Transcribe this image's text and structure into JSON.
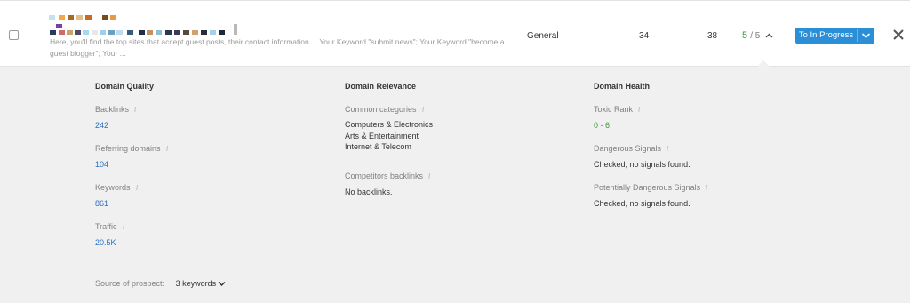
{
  "row": {
    "snippet": "Here, you'll find the top sites that accept guest posts, their contact information ... Your Keyword \"submit news\"; Your Keyword \"become a guest blogger\"; Your ...",
    "type": "General",
    "col_a": "34",
    "col_b": "38",
    "score_value": "5",
    "score_total": "/ 5",
    "status_button": "To In Progress"
  },
  "icons": {
    "checkbox": "checkbox-icon",
    "score_toggle": "chevron-up-icon",
    "status_dropdown": "chevron-down-icon",
    "close": "close-icon",
    "info": "info-icon",
    "source_toggle": "chevron-down-icon"
  },
  "colors": {
    "accent": "#2b8fd8",
    "link_value": "#2a6fbf",
    "good_value": "#3c9a3c",
    "panel_bg": "#f0f0f0"
  },
  "quality": {
    "heading": "Domain Quality",
    "backlinks_label": "Backlinks",
    "backlinks_value": "242",
    "referring_label": "Referring domains",
    "referring_value": "104",
    "keywords_label": "Keywords",
    "keywords_value": "861",
    "traffic_label": "Traffic",
    "traffic_value": "20.5K"
  },
  "relevance": {
    "heading": "Domain Relevance",
    "categories_label": "Common categories",
    "categories": [
      "Computers & Electronics",
      "Arts & Entertainment",
      "Internet & Telecom"
    ],
    "competitors_label": "Competitors backlinks",
    "competitors_value": "No backlinks."
  },
  "health": {
    "heading": "Domain Health",
    "toxic_label": "Toxic Rank",
    "toxic_value": "0 - 6",
    "dangerous_label": "Dangerous Signals",
    "dangerous_value": "Checked, no signals found.",
    "potential_label": "Potentially Dangerous Signals",
    "potential_value": "Checked, no signals found."
  },
  "source": {
    "label": "Source of prospect:",
    "value": "3 keywords"
  }
}
